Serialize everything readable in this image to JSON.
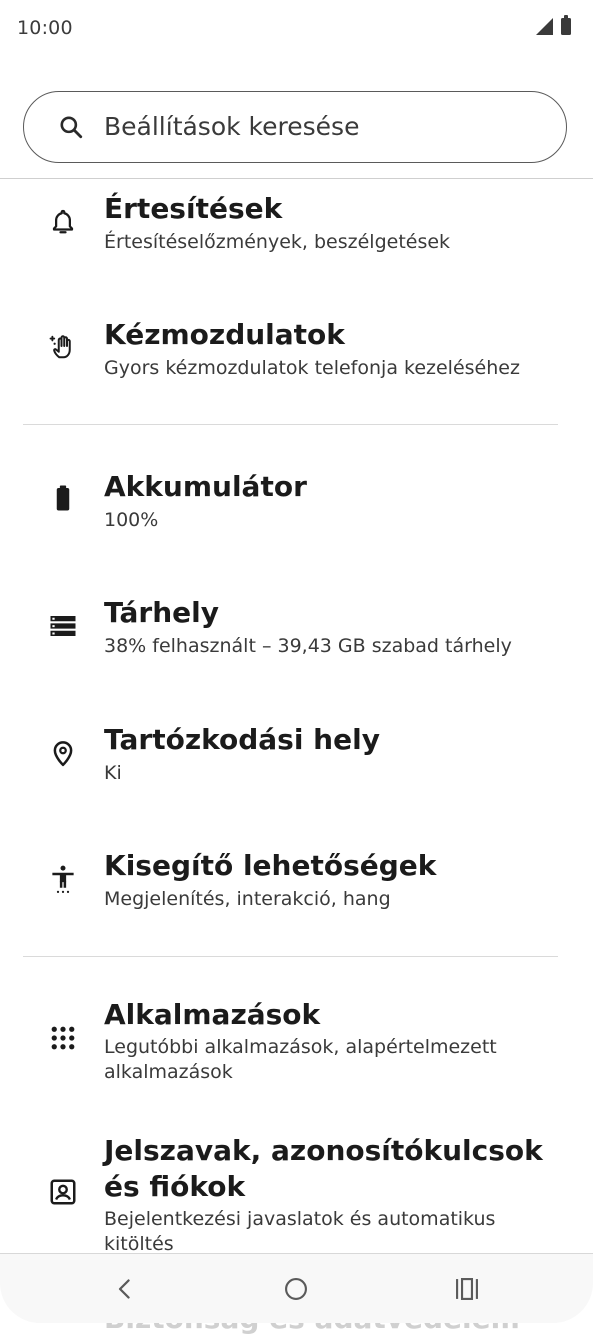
{
  "status_bar": {
    "time": "10:00",
    "signal_icon": "cell-signal-icon",
    "battery_icon": "battery-icon"
  },
  "search": {
    "placeholder": "Beállítások keresése",
    "icon": "search-icon"
  },
  "settings": [
    {
      "icon": "bell-icon",
      "title": "Értesítések",
      "subtitle": "Értesítéselőzmények, beszélgetések"
    },
    {
      "icon": "hand-gesture-icon",
      "title": "Kézmozdulatok",
      "subtitle": "Gyors kézmozdulatok telefonja kezeléséhez"
    },
    {
      "icon": "battery-icon",
      "title": "Akkumulátor",
      "subtitle": "100%"
    },
    {
      "icon": "storage-icon",
      "title": "Tárhely",
      "subtitle": "38% felhasznált – 39,43 GB szabad tárhely"
    },
    {
      "icon": "location-pin-icon",
      "title": "Tartózkodási hely",
      "subtitle": "Ki"
    },
    {
      "icon": "accessibility-icon",
      "title": "Kisegítő lehetőségek",
      "subtitle": "Megjelenítés, interakció, hang"
    },
    {
      "icon": "apps-grid-icon",
      "title": "Alkalmazások",
      "subtitle": "Legutóbbi alkalmazások, alapértelmezett alkalmazások"
    },
    {
      "icon": "account-box-icon",
      "title": "Jelszavak, azonosítókulcsok és fiókok",
      "subtitle": "Bejelentkezési javaslatok és automatikus kitöltés"
    }
  ],
  "partially_visible_item": "Biztonság és adatvédelem",
  "nav": {
    "back": "back-icon",
    "home": "home-icon",
    "recents": "recents-icon"
  }
}
